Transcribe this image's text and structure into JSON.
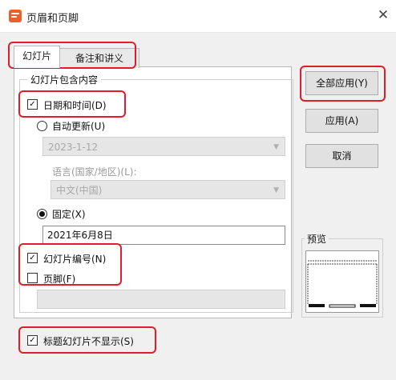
{
  "window": {
    "title": "页眉和页脚",
    "close_glyph": "✕"
  },
  "tabs": [
    {
      "label": "幻灯片",
      "selected": true
    },
    {
      "label": "备注和讲义",
      "selected": false
    }
  ],
  "group": {
    "title": "幻灯片包含内容"
  },
  "date_time": {
    "label": "日期和时间(D)",
    "checked": true,
    "auto_update": {
      "label": "自动更新(U)",
      "selected": false,
      "value": "2023-1-12"
    },
    "language": {
      "label": "语言(国家/地区)(L):",
      "value": "中文(中国)"
    },
    "fixed": {
      "label": "固定(X)",
      "selected": true,
      "value": "2021年6月8日"
    }
  },
  "slide_number": {
    "label": "幻灯片编号(N)",
    "checked": true
  },
  "footer": {
    "label": "页脚(F)",
    "checked": false,
    "value": ""
  },
  "hide_on_title": {
    "label": "标题幻灯片不显示(S)",
    "checked": true
  },
  "buttons": {
    "apply_all": "全部应用(Y)",
    "apply": "应用(A)",
    "cancel": "取消"
  },
  "preview": {
    "label": "预览"
  },
  "colors": {
    "highlight_red": "#e01e2a",
    "app_icon": "#e8602a",
    "dialog_bg": "#f0f0f0"
  }
}
